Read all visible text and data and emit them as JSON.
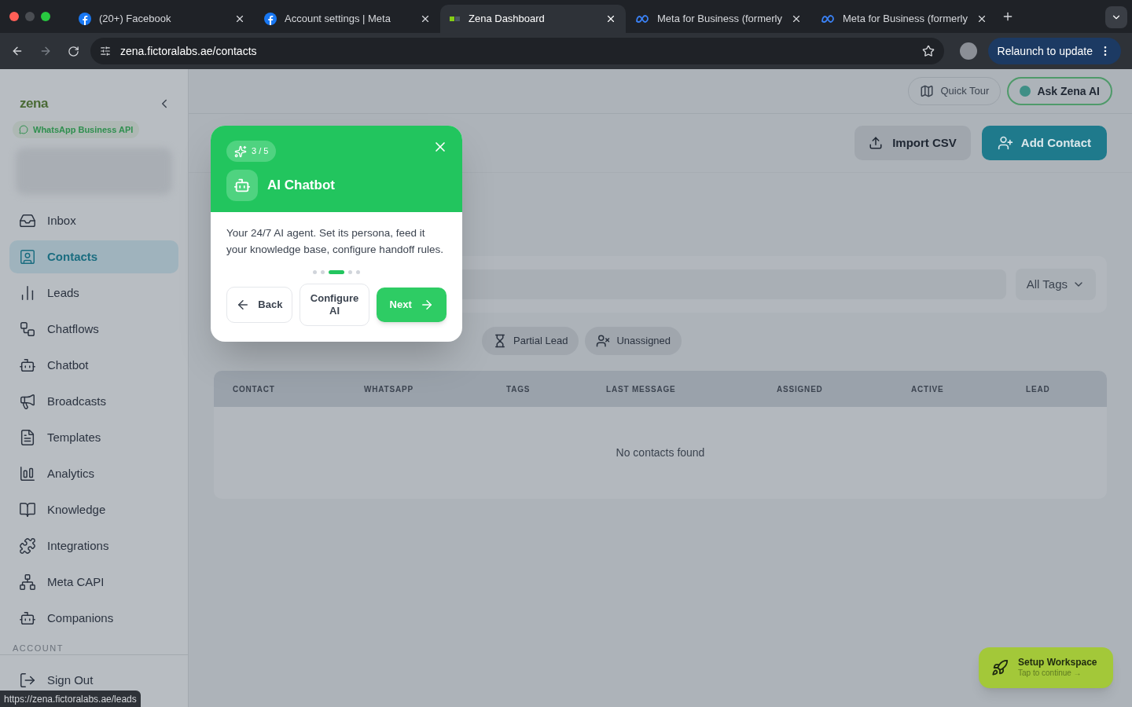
{
  "browser": {
    "tabs": [
      {
        "title": "(20+) Facebook",
        "selected": false
      },
      {
        "title": "Account settings | Meta",
        "selected": false
      },
      {
        "title": "Zena Dashboard",
        "selected": true
      },
      {
        "title": "Meta for Business (formerly",
        "selected": false
      },
      {
        "title": "Meta for Business (formerly",
        "selected": false
      }
    ],
    "url": "zena.fictoralabs.ae/contacts",
    "relaunch": "Relaunch to update",
    "status_url": "https://zena.fictoralabs.ae/leads"
  },
  "sidebar": {
    "logo": "zena",
    "badge": "WhatsApp Business API",
    "items": [
      {
        "label": "Inbox",
        "selected": false
      },
      {
        "label": "Contacts",
        "selected": true
      },
      {
        "label": "Leads",
        "selected": false
      },
      {
        "label": "Chatflows",
        "selected": false
      },
      {
        "label": "Chatbot",
        "selected": false
      },
      {
        "label": "Broadcasts",
        "selected": false
      },
      {
        "label": "Templates",
        "selected": false
      },
      {
        "label": "Analytics",
        "selected": false
      },
      {
        "label": "Knowledge",
        "selected": false
      },
      {
        "label": "Integrations",
        "selected": false
      },
      {
        "label": "Meta CAPI",
        "selected": false
      },
      {
        "label": "Companions",
        "selected": false
      }
    ],
    "section": "ACCOUNT",
    "sign_out": "Sign Out"
  },
  "header": {
    "quick_tour": "Quick Tour",
    "ask_ai": "Ask Zena AI"
  },
  "actions": {
    "import": "Import CSV",
    "add": "Add Contact"
  },
  "filters": {
    "tags": "All Tags",
    "chips": [
      {
        "label": "Partial Lead"
      },
      {
        "label": "Unassigned"
      }
    ]
  },
  "table": {
    "columns": [
      "CONTACT",
      "WHATSAPP",
      "TAGS",
      "LAST MESSAGE",
      "ASSIGNED",
      "ACTIVE",
      "LEAD"
    ],
    "empty": "No contacts found"
  },
  "tour": {
    "step": "3 / 5",
    "title": "AI Chatbot",
    "body": "Your 24/7 AI agent. Set its persona, feed it your knowledge base, configure handoff rules.",
    "dots": [
      {
        "selected": false
      },
      {
        "selected": false
      },
      {
        "selected": true
      },
      {
        "selected": false
      },
      {
        "selected": false
      }
    ],
    "back": "Back",
    "configure": "Configure AI",
    "next": "Next"
  },
  "setup": {
    "title": "Setup Workspace",
    "subtitle": "Tap to continue →"
  }
}
